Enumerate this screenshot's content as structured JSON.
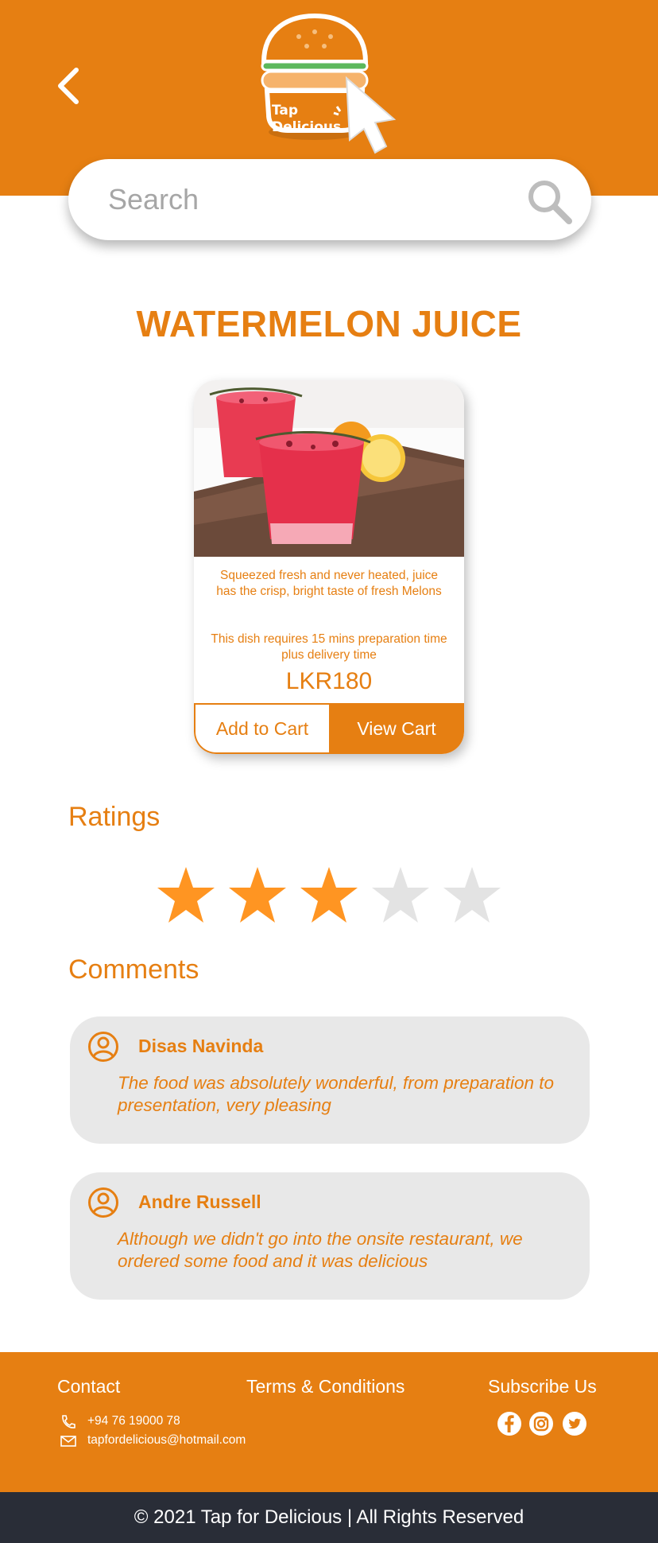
{
  "header": {
    "back_icon": "chevron-left-icon",
    "logo_text_line1": "Tap",
    "logo_text_line2": "Delicious",
    "brand_color": "#E67F12"
  },
  "search": {
    "placeholder": "Search",
    "icon": "search-icon"
  },
  "product": {
    "title": "WATERMELON JUICE",
    "description": "Squeezed fresh and never heated, juice has the crisp, bright taste of fresh Melons",
    "prep_note": "This dish requires 15 mins preparation time plus delivery time",
    "price": "LKR180",
    "add_to_cart_label": "Add to Cart",
    "view_cart_label": "View Cart"
  },
  "ratings": {
    "heading": "Ratings",
    "value": 3,
    "max": 5,
    "filled_color": "#FF9522",
    "empty_color": "#E3E3E3"
  },
  "comments": {
    "heading": "Comments",
    "items": [
      {
        "name": "Disas Navinda",
        "text": "The food was absolutely wonderful, from preparation to presentation, very pleasing"
      },
      {
        "name": "Andre Russell",
        "text": "Although we didn't go into the onsite restaurant, we ordered some food and it was delicious"
      }
    ]
  },
  "footer": {
    "contact_heading": "Contact",
    "phone": "+94 76 19000 78",
    "email": "tapfordelicious@hotmail.com",
    "terms_label": "Terms & Conditions",
    "subscribe_heading": "Subscribe Us",
    "social_icons": [
      "facebook-icon",
      "instagram-icon",
      "twitter-icon"
    ],
    "copyright": "© 2021 Tap for Delicious | All Rights Reserved",
    "copyright_bg": "#292D37"
  }
}
